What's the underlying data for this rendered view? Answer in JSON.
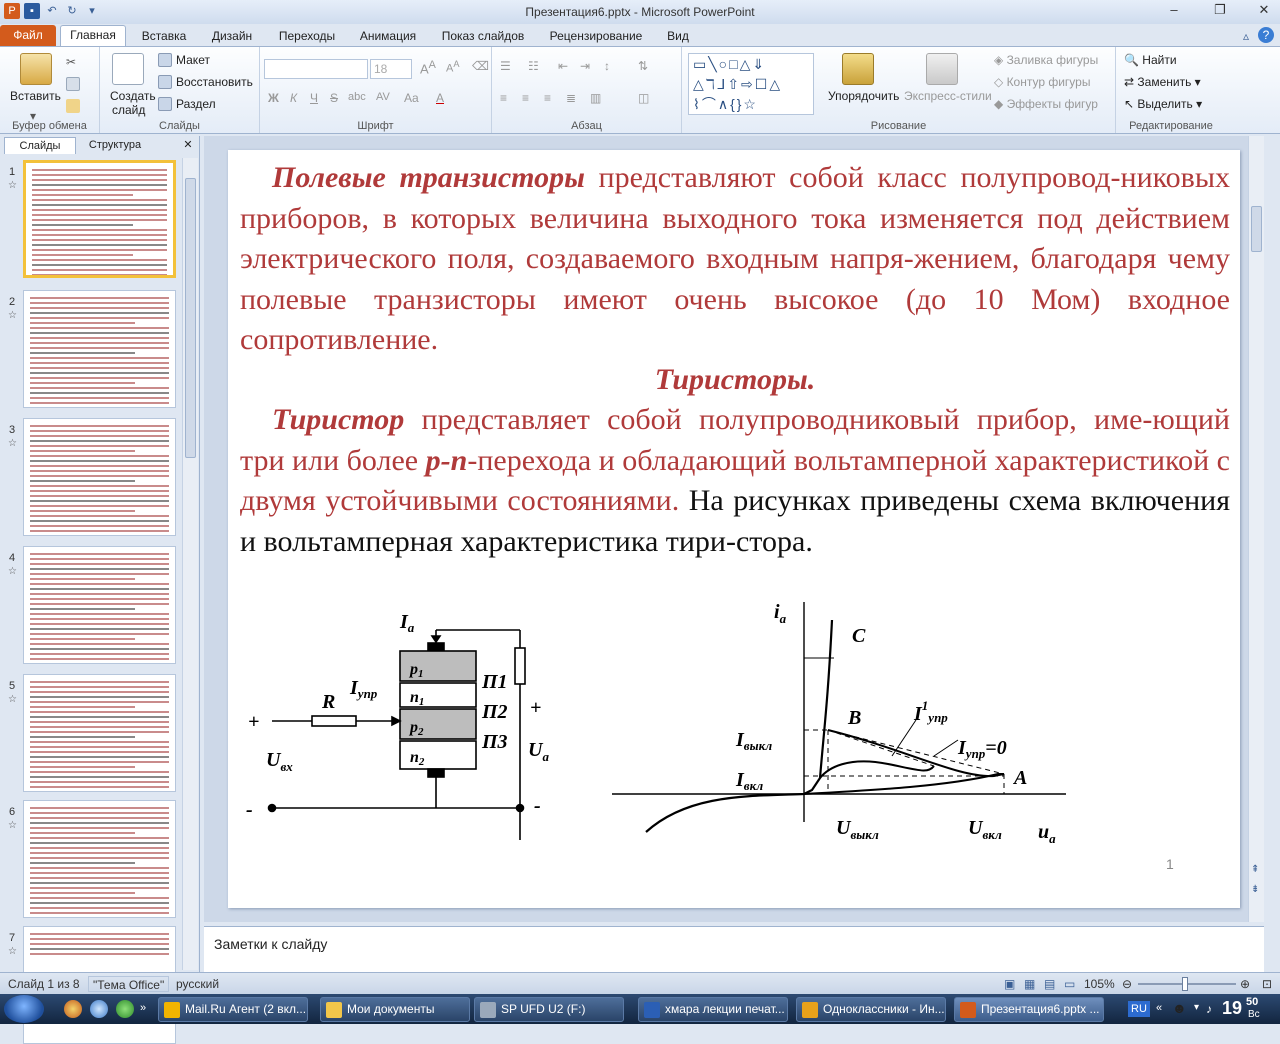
{
  "window": {
    "title": "Презентация6.pptx - Microsoft PowerPoint"
  },
  "ribbon_tabs": [
    {
      "label": "Файл"
    },
    {
      "label": "Главная"
    },
    {
      "label": "Вставка"
    },
    {
      "label": "Дизайн"
    },
    {
      "label": "Переходы"
    },
    {
      "label": "Анимация"
    },
    {
      "label": "Показ слайдов"
    },
    {
      "label": "Рецензирование"
    },
    {
      "label": "Вид"
    }
  ],
  "ribbon": {
    "clipboard": {
      "label": "Буфер обмена",
      "paste": "Вставить"
    },
    "slides": {
      "label": "Слайды",
      "new_slide_line1": "Создать",
      "new_slide_line2": "слайд",
      "layout": "Макет",
      "reset": "Восстановить",
      "section": "Раздел"
    },
    "font": {
      "label": "Шрифт",
      "size": "18",
      "bold": "Ж",
      "italic": "К",
      "underline": "Ч",
      "strike": "S",
      "shadow": "abc",
      "spacing": "AV",
      "case": "Aa",
      "color": "A"
    },
    "paragraph": {
      "label": "Абзац"
    },
    "drawing": {
      "label": "Рисование",
      "arrange": "Упорядочить",
      "quick_styles": "Экспресс-стили",
      "fill": "Заливка фигуры",
      "outline": "Контур фигуры",
      "effects": "Эффекты фигур"
    },
    "editing": {
      "label": "Редактирование",
      "find": "Найти",
      "replace": "Заменить",
      "select": "Выделить"
    }
  },
  "panel": {
    "tab_slides": "Слайды",
    "tab_outline": "Структура",
    "thumbs": [
      {
        "num": "1"
      },
      {
        "num": "2"
      },
      {
        "num": "3"
      },
      {
        "num": "4"
      },
      {
        "num": "5"
      },
      {
        "num": "6"
      },
      {
        "num": "7"
      }
    ]
  },
  "slide": {
    "p1_bold": "Полевые транзисторы",
    "p1_rest": " представляют собой класс полупровод-никовых приборов, в которых величина выходного тока изменяется под действием электрического поля, создаваемого входным напря-жением, благодаря чему полевые транзисторы имеют очень высокое (до 10 Мом) входное сопротивление.",
    "heading": "Тиристоры.",
    "p2_bold": "Тиристор",
    "p2_a": " представляет собой полупроводниковый прибор, име-ющий три или более ",
    "p2_pn": "р-п",
    "p2_b": "-перехода и обладающий вольтамперной характеристикой с двумя устойчивыми состояниями.",
    "p2_black": " На рисунках приведены схема включения и вольтамперная характеристика тири-стора.",
    "slide_number": "1",
    "circuit": {
      "Ia": "I",
      "Ia_sub": "a",
      "p1": "p",
      "p1_sub": "1",
      "n1": "n",
      "n1_sub": "1",
      "p2": "p",
      "p2_sub": "2",
      "n2": "n",
      "n2_sub": "2",
      "P1": "П1",
      "P2": "П2",
      "P3": "П3",
      "R": "R",
      "Iupr": "I",
      "Iupr_sub": "упр",
      "Uvx": "U",
      "Uvx_sub": "вх",
      "Ua": "U",
      "Ua_sub": "a",
      "plus_left": "+",
      "plus_right": "+",
      "minus_left": "-",
      "minus_right": "-"
    },
    "graph": {
      "ia": "i",
      "ia_sub": "a",
      "C": "C",
      "B": "B",
      "A": "A",
      "I1upr": "I",
      "I1upr_sup": "1",
      "I1upr_sub": "упр",
      "Iupr0": "I",
      "Iupr0_sub": "упр",
      "Iupr0_tail": "=0",
      "Ivykl": "I",
      "Ivykl_sub": "выкл",
      "Ivkl": "I",
      "Ivkl_sub": "вкл",
      "Uvykl": "U",
      "Uvykl_sub": "выкл",
      "Uvkl": "U",
      "Uvkl_sub": "вкл",
      "ua": "u",
      "ua_sub": "a"
    }
  },
  "notes": {
    "placeholder": "Заметки к слайду"
  },
  "status": {
    "slide": "Слайд 1 из 8",
    "theme": "\"Тема Office\"",
    "lang": "русский",
    "zoom": "105%"
  },
  "taskbar": {
    "items": [
      {
        "label": "Mail.Ru Агент (2 вкл...",
        "color": "#f2b400"
      },
      {
        "label": "Мои документы",
        "color": "#f2c64a"
      },
      {
        "label": "SP UFD U2 (F:)",
        "color": "#9aa9bb"
      },
      {
        "label": "хмара лекции печат...",
        "color": "#2b5fb5"
      },
      {
        "label": "Одноклассники - Ин...",
        "color": "#e8a21b"
      },
      {
        "label": "Презентация6.pptx ...",
        "color": "#d35b1c"
      }
    ],
    "lang": "RU",
    "time": "19",
    "time_min": "50",
    "day": "Вс"
  }
}
